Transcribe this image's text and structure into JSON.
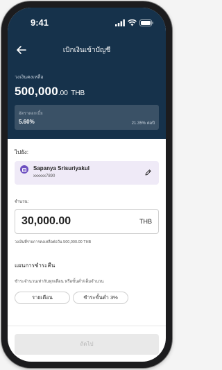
{
  "status_bar": {
    "time": "9:41",
    "icons": [
      "signal-icon",
      "wifi-icon",
      "battery-icon"
    ]
  },
  "header": {
    "title": "เบิกเงินเข้าบัญชี"
  },
  "balance": {
    "label": "วงเงินคงเหลือ",
    "amount": "500,000",
    "decimals": ".00",
    "currency": "THB"
  },
  "rate": {
    "label": "อัตราดอกเบี้ย",
    "value": "5.60%",
    "right_text": "21.35% ต่อปี"
  },
  "recipient": {
    "section_label": "ไปยัง:",
    "name": "Sapanya Srisuriyakul",
    "account": "xxxxxx7890"
  },
  "amount": {
    "label": "จำนวน:",
    "value": "30,000.00",
    "currency": "THB",
    "hint": "วงเงินที่รายการคงเหลือต่อวัน 500,000.00 THB"
  },
  "plan": {
    "title": "แผนการชำระคืน",
    "description": "ชำระจำนวนเท่ากันทุกเดือน หรือขั้นต่ำ/เต็มจำนวน",
    "options": [
      "รายเดือน",
      "ชำระขั้นต่ำ 3%"
    ]
  },
  "footer": {
    "next_label": "ถัดไป"
  },
  "colors": {
    "header_bg": "#16324b",
    "rate_box_bg": "#3a5166",
    "recipient_bg": "#efeaf7",
    "avatar": "#6d4fc0",
    "disabled_button": "#e9e9e9"
  }
}
